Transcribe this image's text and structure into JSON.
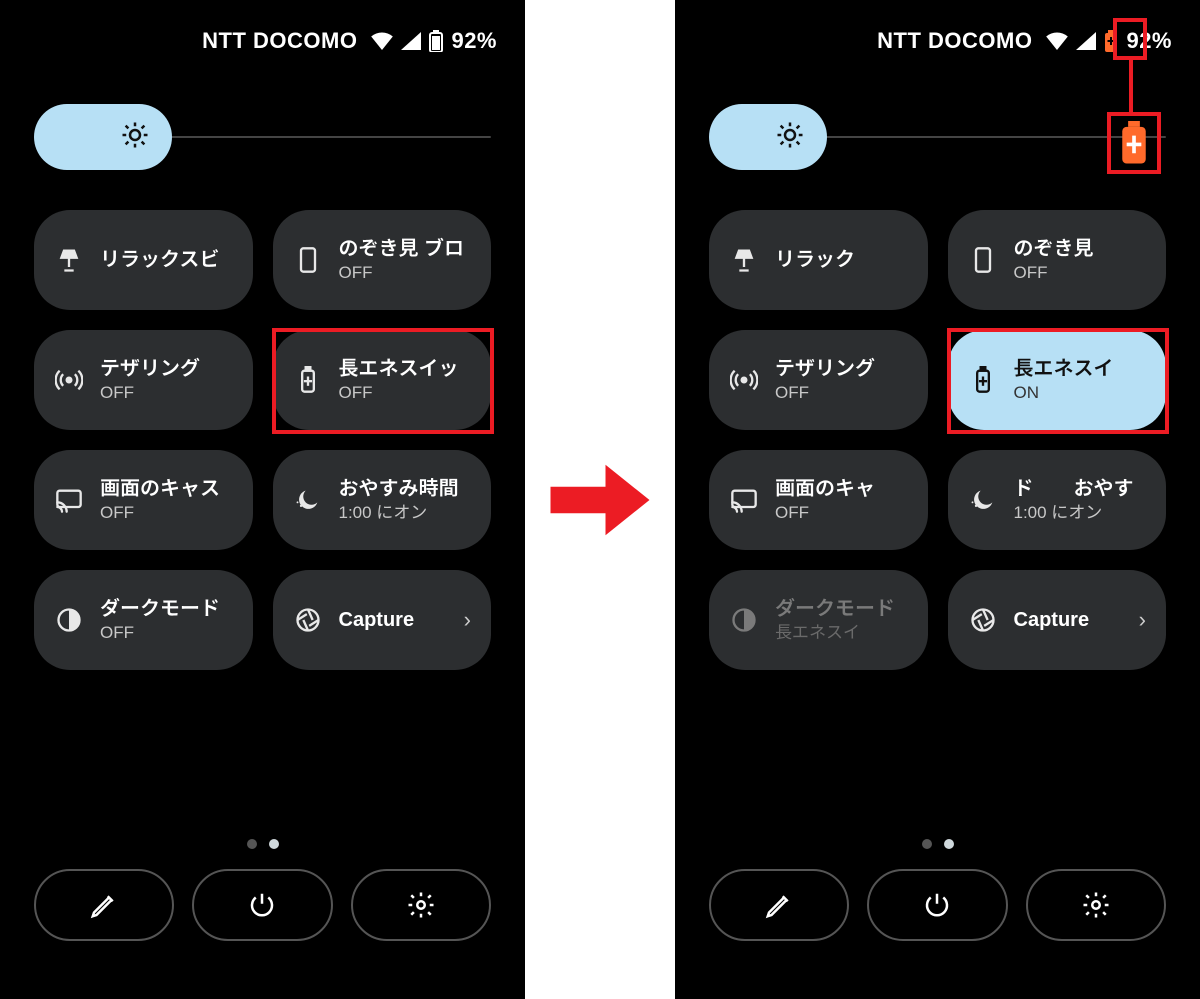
{
  "status": {
    "carrier": "NTT DOCOMO",
    "battery_pct": "92%"
  },
  "colors": {
    "accent": "#b7e0f5",
    "highlight": "#ec1c24",
    "tile_bg": "#2c2e30"
  },
  "left": {
    "tiles": [
      {
        "id": "relax",
        "title": "リラックスビ",
        "sub": ""
      },
      {
        "id": "peek",
        "title": "のぞき見 ブロ",
        "sub": "OFF"
      },
      {
        "id": "tether",
        "title": "テザリング",
        "sub": "OFF"
      },
      {
        "id": "energy",
        "title": "長エネスイッ",
        "sub": "OFF"
      },
      {
        "id": "cast",
        "title": "画面のキャス",
        "sub": "OFF"
      },
      {
        "id": "bedtime",
        "title": "おやすみ時間",
        "sub": "1:00 にオン"
      },
      {
        "id": "dark",
        "title": "ダークモード",
        "sub": "OFF"
      },
      {
        "id": "capture",
        "title": "Capture",
        "sub": ""
      }
    ]
  },
  "right": {
    "tiles": [
      {
        "id": "relax",
        "title": "リラック",
        "sub": ""
      },
      {
        "id": "peek",
        "title": "のぞき見",
        "sub": "OFF"
      },
      {
        "id": "tether",
        "title": "テザリング",
        "sub": "OFF"
      },
      {
        "id": "energy",
        "title": "長エネスイ",
        "sub": "ON"
      },
      {
        "id": "cast",
        "title": "画面のキャ",
        "sub": "OFF"
      },
      {
        "id": "bedtime",
        "title": "ド　　おやす",
        "sub": "1:00 にオン"
      },
      {
        "id": "dark",
        "title": "ダークモード",
        "sub": "長エネスイ"
      },
      {
        "id": "capture",
        "title": "Capture",
        "sub": ""
      }
    ]
  }
}
